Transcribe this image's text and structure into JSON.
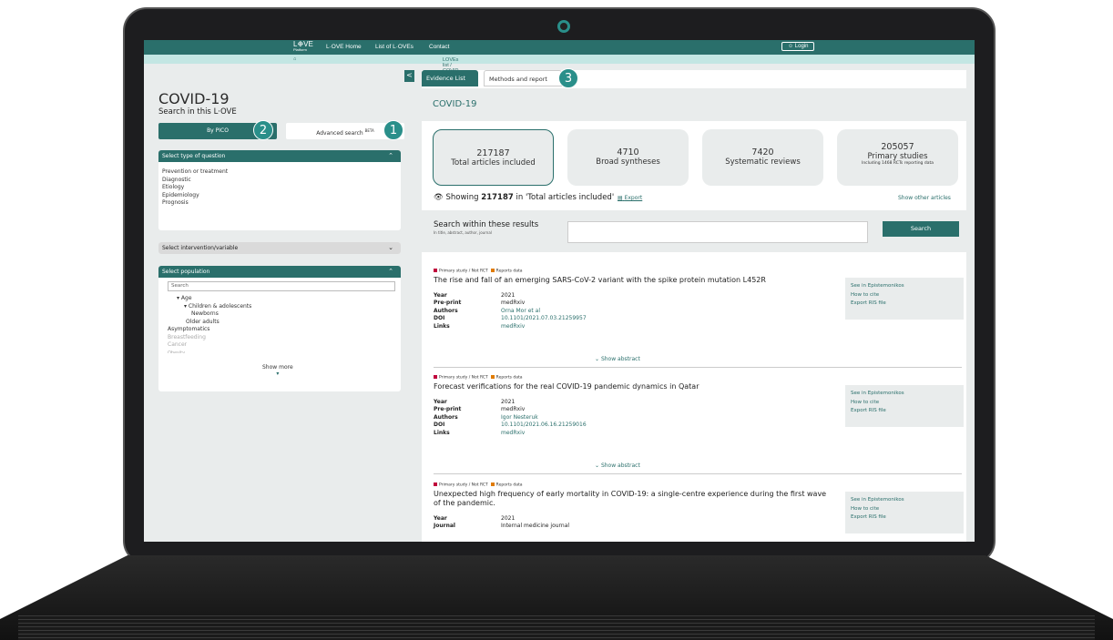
{
  "nav": {
    "logo": "L❉VE",
    "logo_sub": "Platform",
    "links": [
      "L·OVE Home",
      "List of L·OVEs",
      "Contact"
    ],
    "login": "Login"
  },
  "breadcrumb": "LOVEs list / COVID-19",
  "left": {
    "collapse": "<",
    "title": "COVID-19",
    "subtitle": "Search in this L·OVE",
    "tab_pico": "By PICO",
    "tab_advanced": "Advanced search",
    "tab_advanced_sup": "BETA",
    "badges": [
      "1",
      "2",
      "3"
    ],
    "question_head": "Select type of question",
    "question_items": [
      "Prevention or treatment",
      "Diagnostic",
      "Etiology",
      "Epidemiology",
      "Prognosis"
    ],
    "intervention_head": "Select intervention/variable",
    "population_head": "Select population",
    "population_search": "Search",
    "population_tree": [
      "▾ Age",
      "▾ Children & adolescents",
      "Newborns",
      "Older adults",
      "Asymptomatics",
      "Breastfeeding",
      "Cancer",
      "Obesity"
    ],
    "show_more": "Show more"
  },
  "right": {
    "tab_evidence": "Evidence List",
    "tab_methods": "Methods and report",
    "header": "COVID-19",
    "stats": [
      {
        "num": "217187",
        "label": "Total articles included",
        "sub": ""
      },
      {
        "num": "4710",
        "label": "Broad syntheses",
        "sub": ""
      },
      {
        "num": "7420",
        "label": "Systematic reviews",
        "sub": ""
      },
      {
        "num": "205057",
        "label": "Primary studies",
        "sub": "Including 1468 RCTs reporting data"
      }
    ],
    "showing_pre": "Showing",
    "showing_num": "217187",
    "showing_post": "in 'Total articles included'",
    "export": "Export",
    "show_other": "Show other articles",
    "search_title": "Search within these results",
    "search_sub": "In title, abstract, author, journal",
    "search_btn": "Search",
    "articles": [
      {
        "tag1": "Primary study / Not RCT",
        "tag2": "Reports data",
        "title": "The rise and fall of an emerging SARS-CoV-2 variant with the spike protein mutation L452R",
        "year": "2021",
        "preprint": "medRxiv",
        "authors": "Orna Mor et al",
        "doi": "10.1101/2021.07.03.21259957",
        "links": "medRxiv"
      },
      {
        "tag1": "Primary study / Not RCT",
        "tag2": "Reports data",
        "title": "Forecast verifications for the real COVID-19 pandemic dynamics in Qatar",
        "year": "2021",
        "preprint": "medRxiv",
        "authors": "Igor Nesteruk",
        "doi": "10.1101/2021.06.16.21259016",
        "links": "medRxiv"
      },
      {
        "tag1": "Primary study / Not RCT",
        "tag2": "Reports data",
        "title": "Unexpected high frequency of early mortality in COVID-19: a single-centre experience during the first wave of the pandemic.",
        "year": "2021",
        "journal": "Internal medicine journal"
      }
    ],
    "labels": {
      "year": "Year",
      "preprint": "Pre-print",
      "authors": "Authors",
      "doi": "DOI",
      "links": "Links",
      "journal": "Journal"
    },
    "side": [
      "See in Epistemonikos",
      "How to cite",
      "Export RIS file"
    ],
    "show_abstract": "Show abstract"
  },
  "colors": {
    "brand": "#2a6f6b",
    "badge": "#2a8f8a",
    "tag_red": "#c0003c",
    "tag_orange": "#e07b00"
  }
}
